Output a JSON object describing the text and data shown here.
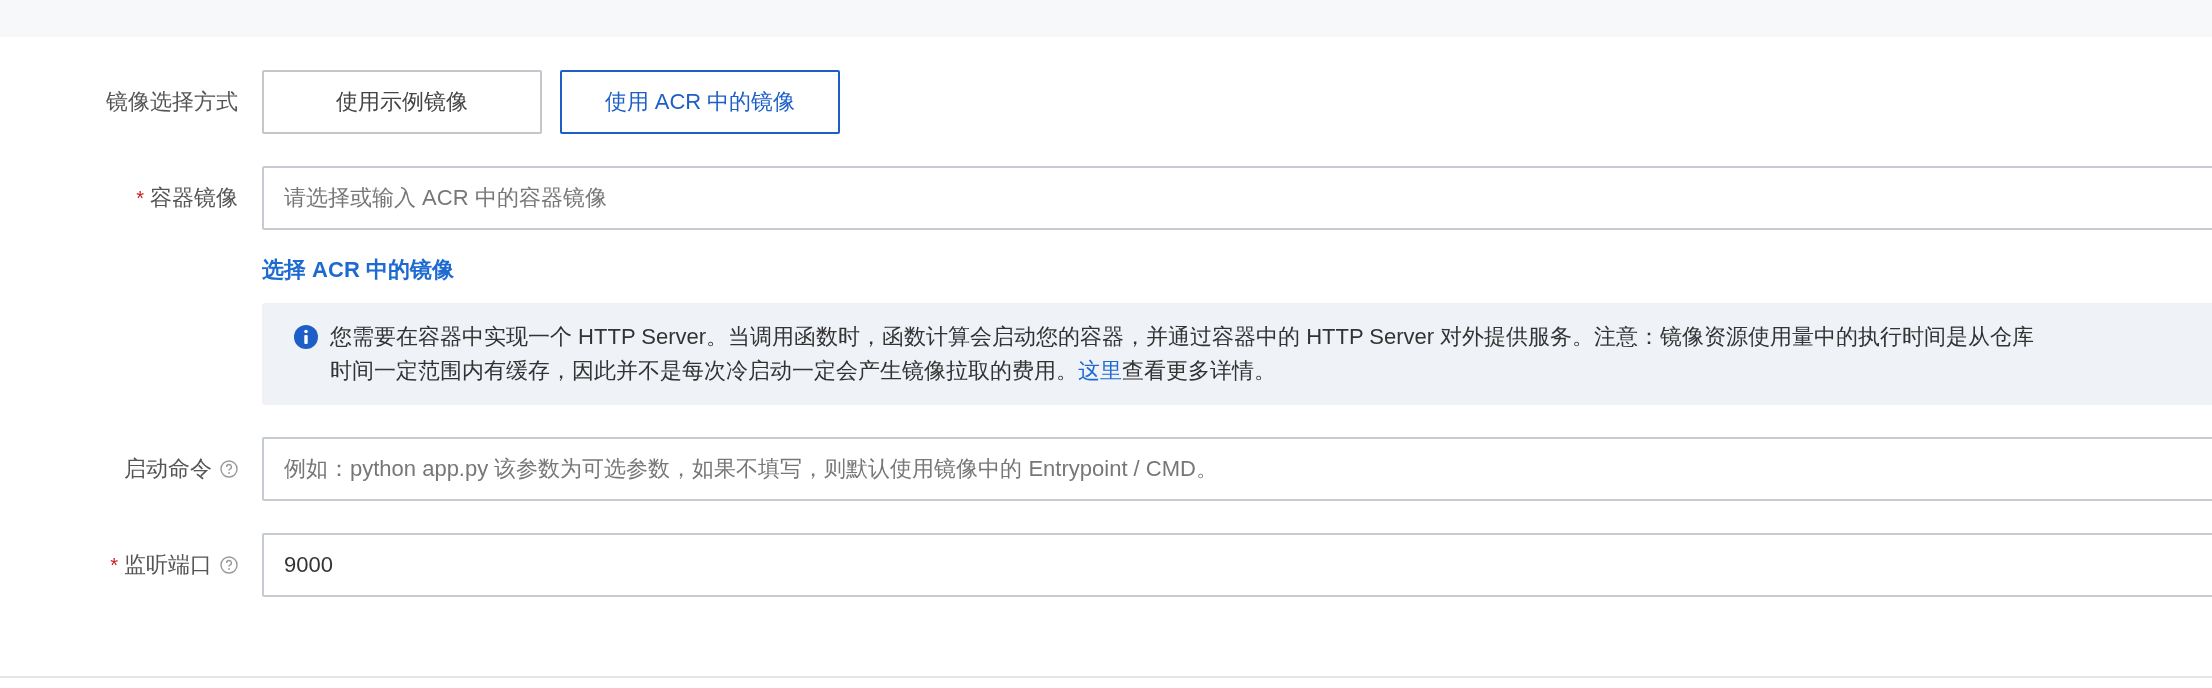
{
  "image_source": {
    "label": "镜像选择方式",
    "options": [
      {
        "label": "使用示例镜像",
        "selected": false
      },
      {
        "label": "使用 ACR 中的镜像",
        "selected": true
      }
    ]
  },
  "container_image": {
    "label": "容器镜像",
    "required_mark": "*",
    "placeholder": "请选择或输入 ACR 中的容器镜像",
    "link": "选择 ACR 中的镜像",
    "notice": {
      "line_1": "您需要在容器中实现一个 HTTP Server。当调用函数时，函数计算会启动您的容器，并通过容器中的 HTTP Server 对外提供服务。注意：镜像资源使用量中的执行时间是从仓库",
      "line_2": "时间一定范围内有缓存，因此并不是每次冷启动一定会产生镜像拉取的费用。",
      "link": "这里",
      "after_link": "查看更多详情。"
    }
  },
  "fields": [
    {
      "label": "启动命令",
      "help": true,
      "placeholder": "例如：python app.py 该参数为可选参数，如果不填写，则默认使用镜像中的 Entrypoint / CMD。"
    },
    {
      "label": "监听端口",
      "required_mark": "*",
      "help": true,
      "value": "9000"
    }
  ]
}
